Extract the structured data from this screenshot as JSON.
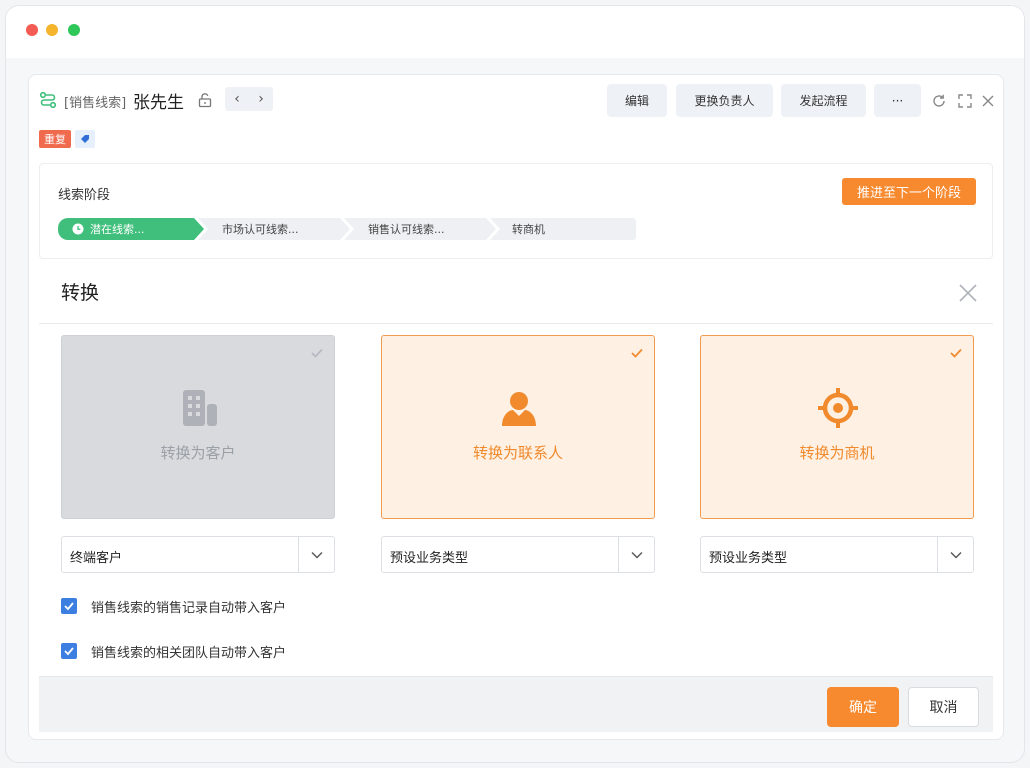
{
  "header": {
    "title_prefix": "[销售线索]",
    "title_name": "张先生",
    "toolbar": {
      "edit_label": "编辑",
      "change_owner_label": "更换负责人",
      "start_flow_label": "发起流程",
      "more_label": "···"
    },
    "tags": {
      "duplicate_label": "重复"
    }
  },
  "stage_panel": {
    "title": "线索阶段",
    "advance_label": "推进至下一个阶段",
    "stages": [
      {
        "label": "潜在线索...",
        "active": true
      },
      {
        "label": "市场认可线索...",
        "active": false
      },
      {
        "label": "销售认可线索...",
        "active": false
      },
      {
        "label": "转商机",
        "active": false
      }
    ]
  },
  "dialog": {
    "title": "转换",
    "options": [
      {
        "label": "转换为客户",
        "selected": false,
        "icon": "building-icon"
      },
      {
        "label": "转换为联系人",
        "selected": true,
        "icon": "person-icon"
      },
      {
        "label": "转换为商机",
        "selected": true,
        "icon": "target-icon"
      }
    ],
    "selects": [
      {
        "value": "终端客户"
      },
      {
        "value": "预设业务类型"
      },
      {
        "value": "预设业务类型"
      }
    ],
    "checkboxes": [
      {
        "label": "销售线索的销售记录自动带入客户",
        "checked": true
      },
      {
        "label": "销售线索的相关团队自动带入客户",
        "checked": true
      }
    ],
    "ok_label": "确定",
    "cancel_label": "取消"
  },
  "colors": {
    "accent_orange": "#f7892f",
    "stage_green": "#3fbf7b",
    "checkbox_blue": "#3d7fe0",
    "tag_red": "#f06a4e"
  }
}
